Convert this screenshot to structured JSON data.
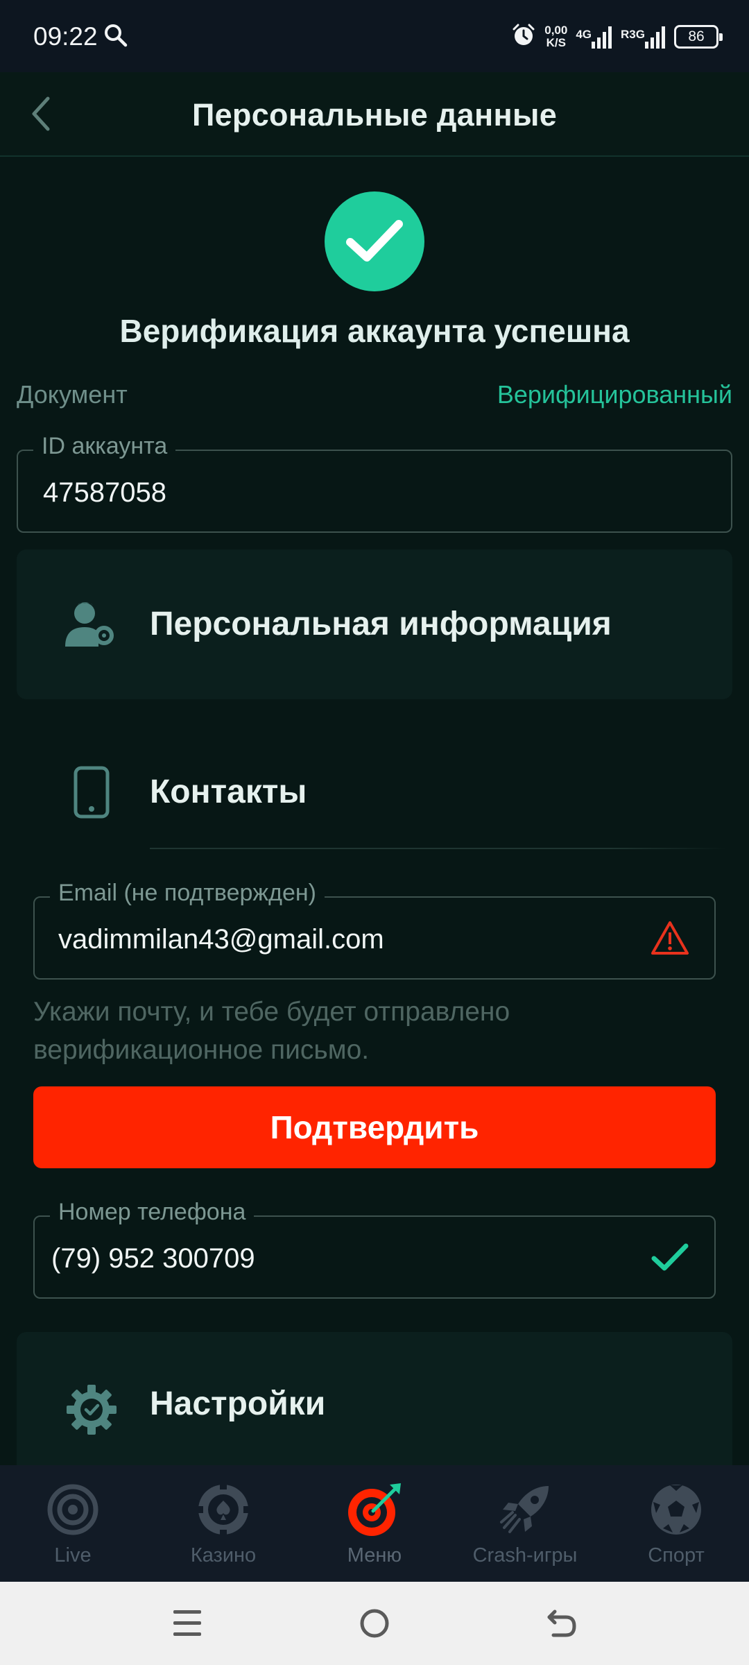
{
  "status_bar": {
    "time": "09:22",
    "net_speed_value": "0,00",
    "net_speed_unit": "K/S",
    "network_1": "4G",
    "network_2": "R3G",
    "battery": "86"
  },
  "header": {
    "title": "Персональные данные"
  },
  "verification": {
    "message": "Верификация аккаунта успешна",
    "document_label": "Документ",
    "document_status": "Верифицированный"
  },
  "account_id": {
    "label": "ID аккаунта",
    "value": "47587058"
  },
  "sections": {
    "personal_info": "Персональная информация",
    "contacts": "Контакты",
    "settings": "Настройки"
  },
  "email": {
    "label": "Email (не подтвержден)",
    "value": "vadimmilan43@gmail.com",
    "hint": "Укажи почту, и тебе будет отправлено верификационное письмо.",
    "confirm_label": "Подтвердить"
  },
  "phone": {
    "label": "Номер телефона",
    "value": "(79) 952 300709"
  },
  "bottom_nav": [
    {
      "label": "Live",
      "icon": "live-icon"
    },
    {
      "label": "Казино",
      "icon": "casino-chip-icon"
    },
    {
      "label": "Меню",
      "icon": "dartboard-icon"
    },
    {
      "label": "Crash-игры",
      "icon": "rocket-icon"
    },
    {
      "label": "Спорт",
      "icon": "soccer-ball-icon"
    }
  ],
  "colors": {
    "accent_green": "#1fcd9c",
    "confirm_red": "#ff2400",
    "warning_red": "#e8321d",
    "background": "#071715"
  }
}
